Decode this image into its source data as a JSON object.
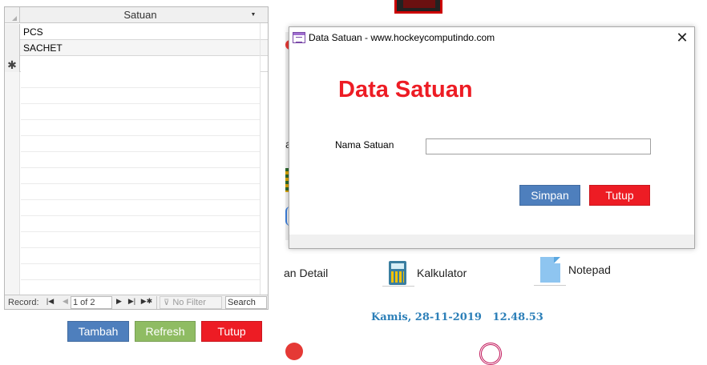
{
  "subform": {
    "column_header": "Satuan",
    "rows": [
      {
        "selector": "",
        "value": "PCS"
      },
      {
        "selector": "",
        "value": "SACHET"
      }
    ],
    "new_row_marker": "✱",
    "nav": {
      "record_label": "Record:",
      "first": "|◀",
      "prev": "◀",
      "position": "1 of 2",
      "next": "▶",
      "last": "▶|",
      "new": "▶✱",
      "filter_label": "No Filter",
      "search_placeholder": "Search"
    }
  },
  "buttons": {
    "tambah": "Tambah",
    "refresh": "Refresh",
    "tutup": "Tutup"
  },
  "background": {
    "detail_fragment": "an Detail",
    "frag_a": "a",
    "kalkulator": "Kalkulator",
    "notepad": "Notepad",
    "datetime": "Kamis, 28-11-2019   12.48.53"
  },
  "dialog": {
    "title": "Data Satuan - www.hockeycomputindo.com",
    "close": "✕",
    "heading": "Data Satuan",
    "field_label": "Nama Satuan",
    "field_value": "",
    "simpan": "Simpan",
    "tutup": "Tutup"
  },
  "colors": {
    "heading_red": "#ed1c24",
    "button_blue": "#4e7fbd",
    "button_green": "#8fbc63",
    "button_red": "#ed1c24",
    "datetime_blue": "#2c7fb8"
  }
}
